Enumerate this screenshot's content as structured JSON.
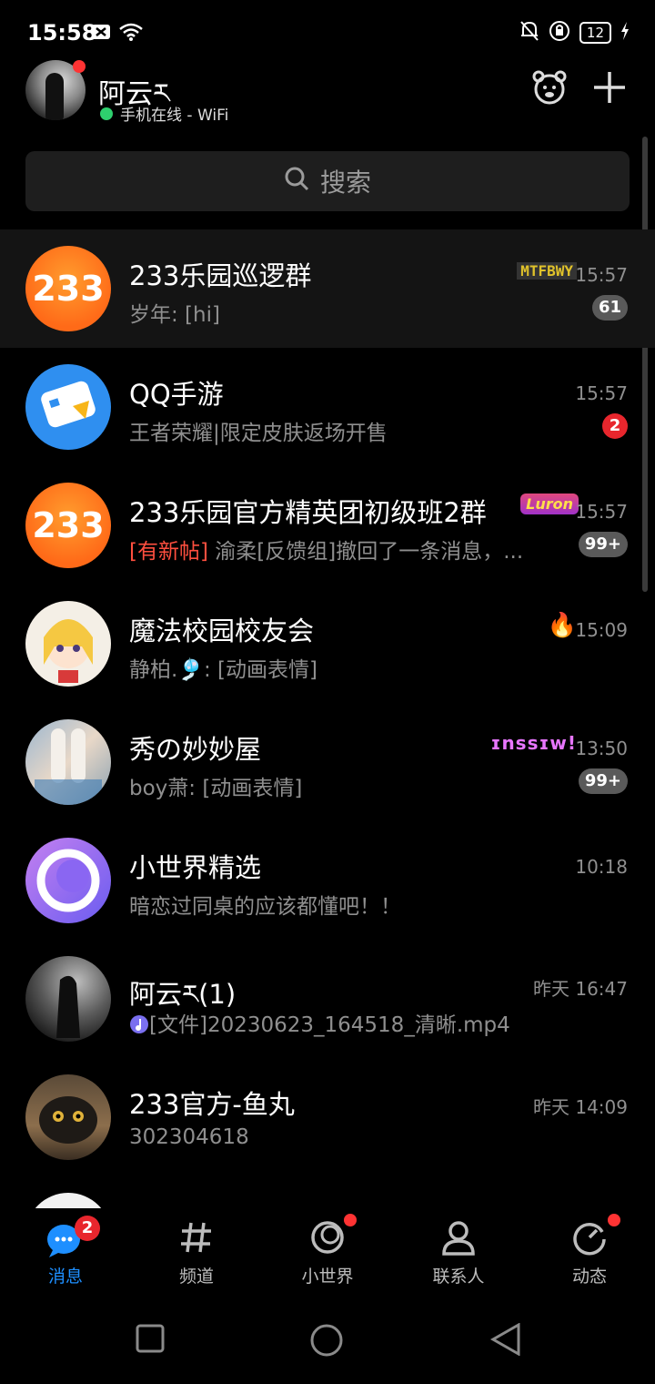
{
  "status_bar": {
    "time": "15:58",
    "battery": "12"
  },
  "header": {
    "username": "阿云ར",
    "presence": "手机在线 - WiFi"
  },
  "search": {
    "placeholder": "搜索"
  },
  "conversations": [
    {
      "title": "233乐园巡逻群",
      "message": "岁年: [hi]",
      "time": "15:57",
      "badge": "61",
      "badge_style": "gray",
      "tag": "MTFBWY"
    },
    {
      "title": "QQ手游",
      "message": "王者荣耀|限定皮肤返场开售",
      "time": "15:57",
      "badge": "2",
      "badge_style": "red"
    },
    {
      "title": "233乐园官方精英团初级班2群",
      "message_highlight": "[有新帖]",
      "message": " 渝柔[反馈组]撤回了一条消息，...",
      "time": "15:57",
      "badge": "99+",
      "badge_style": "gray",
      "tag": "Luron"
    },
    {
      "title": "魔法校园校友会",
      "message": "静柏.🎐: [动画表情]",
      "time": "15:09",
      "tag": "🔥"
    },
    {
      "title": "秀の妙妙屋",
      "message": "boy萧: [动画表情]",
      "time": "13:50",
      "badge": "99+",
      "badge_style": "gray",
      "tag": "ɪnssɪw!"
    },
    {
      "title": "小世界精选",
      "message": "暗恋过同桌的应该都懂吧！！",
      "time": "10:18"
    },
    {
      "title": "阿云ར(1)",
      "message": "[文件]20230623_164518_清晰.mp4",
      "time": "昨天 16:47"
    },
    {
      "title": "233官方-鱼丸",
      "message": "302304618",
      "time": "昨天 14:09"
    }
  ],
  "tabs": [
    {
      "label": "消息",
      "badge": "2"
    },
    {
      "label": "频道"
    },
    {
      "label": "小世界"
    },
    {
      "label": "联系人"
    },
    {
      "label": "动态"
    }
  ],
  "colors": {
    "accent": "#1e8fff",
    "badge_red": "#e8262d",
    "online": "#2ed06e",
    "highlight": "#ff4f3f"
  }
}
